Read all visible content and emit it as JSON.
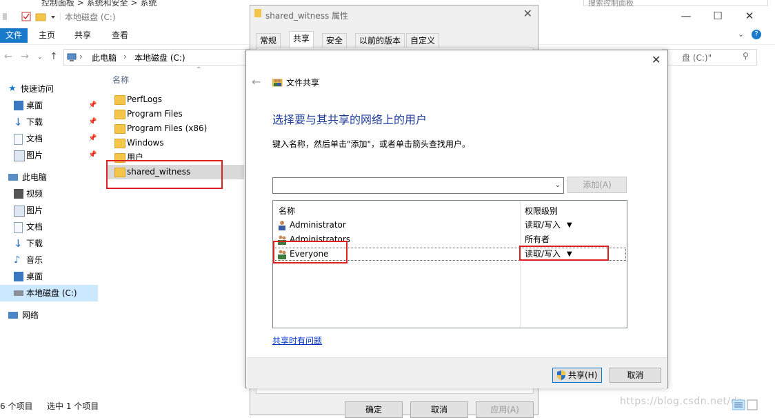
{
  "top_strip": {
    "breadcrumb_partial": "控制面板  >  系统和安全  >  系统",
    "search_partial": "搜索控制面板"
  },
  "explorer": {
    "title": "本地磁盘 (C:)",
    "ribbon_tabs": [
      "文件",
      "主页",
      "共享",
      "查看"
    ],
    "address": {
      "pc": "此电脑",
      "drive": "本地磁盘 (C:)"
    },
    "search_placeholder": "盘 (C:)\"",
    "nav": {
      "quick_access": "快速访问",
      "quick_items": [
        "桌面",
        "下载",
        "文档",
        "图片"
      ],
      "this_pc": "此电脑",
      "pc_items": [
        "视频",
        "图片",
        "文档",
        "下载",
        "音乐",
        "桌面",
        "本地磁盘 (C:)"
      ],
      "network": "网络"
    },
    "column_name": "名称",
    "files": [
      "PerfLogs",
      "Program Files",
      "Program Files (x86)",
      "Windows",
      "用户",
      "shared_witness"
    ],
    "status": {
      "count": "6 个项目",
      "selected": "选中 1 个项目"
    }
  },
  "properties": {
    "title": "shared_witness 属性",
    "tabs": [
      "常规",
      "共享",
      "安全",
      "以前的版本",
      "自定义"
    ],
    "buttons": {
      "ok": "确定",
      "cancel": "取消",
      "apply": "应用(A)"
    }
  },
  "share_dialog": {
    "title": "文件共享",
    "heading": "选择要与其共享的网络上的用户",
    "instruction": "键入名称，然后单击\"添加\"，或者单击箭头查找用户。",
    "combo_value": "",
    "add_button": "添加(A)",
    "columns": {
      "name": "名称",
      "permission": "权限级别"
    },
    "users": [
      {
        "name": "Administrator",
        "permission": "读取/写入",
        "has_dropdown": true
      },
      {
        "name": "Administrators",
        "permission": "所有者",
        "has_dropdown": false
      },
      {
        "name": "Everyone",
        "permission": "读取/写入",
        "has_dropdown": true
      }
    ],
    "help_link": "共享时有问题",
    "share_button": "共享(H)",
    "cancel_button": "取消"
  },
  "watermark": "https://blog.csdn.net/da",
  "colors": {
    "accent": "#1979ca",
    "heading": "#1f3d99",
    "highlight_red": "#e02020",
    "folder": "#f3c54a",
    "selection": "#cce8ff"
  }
}
